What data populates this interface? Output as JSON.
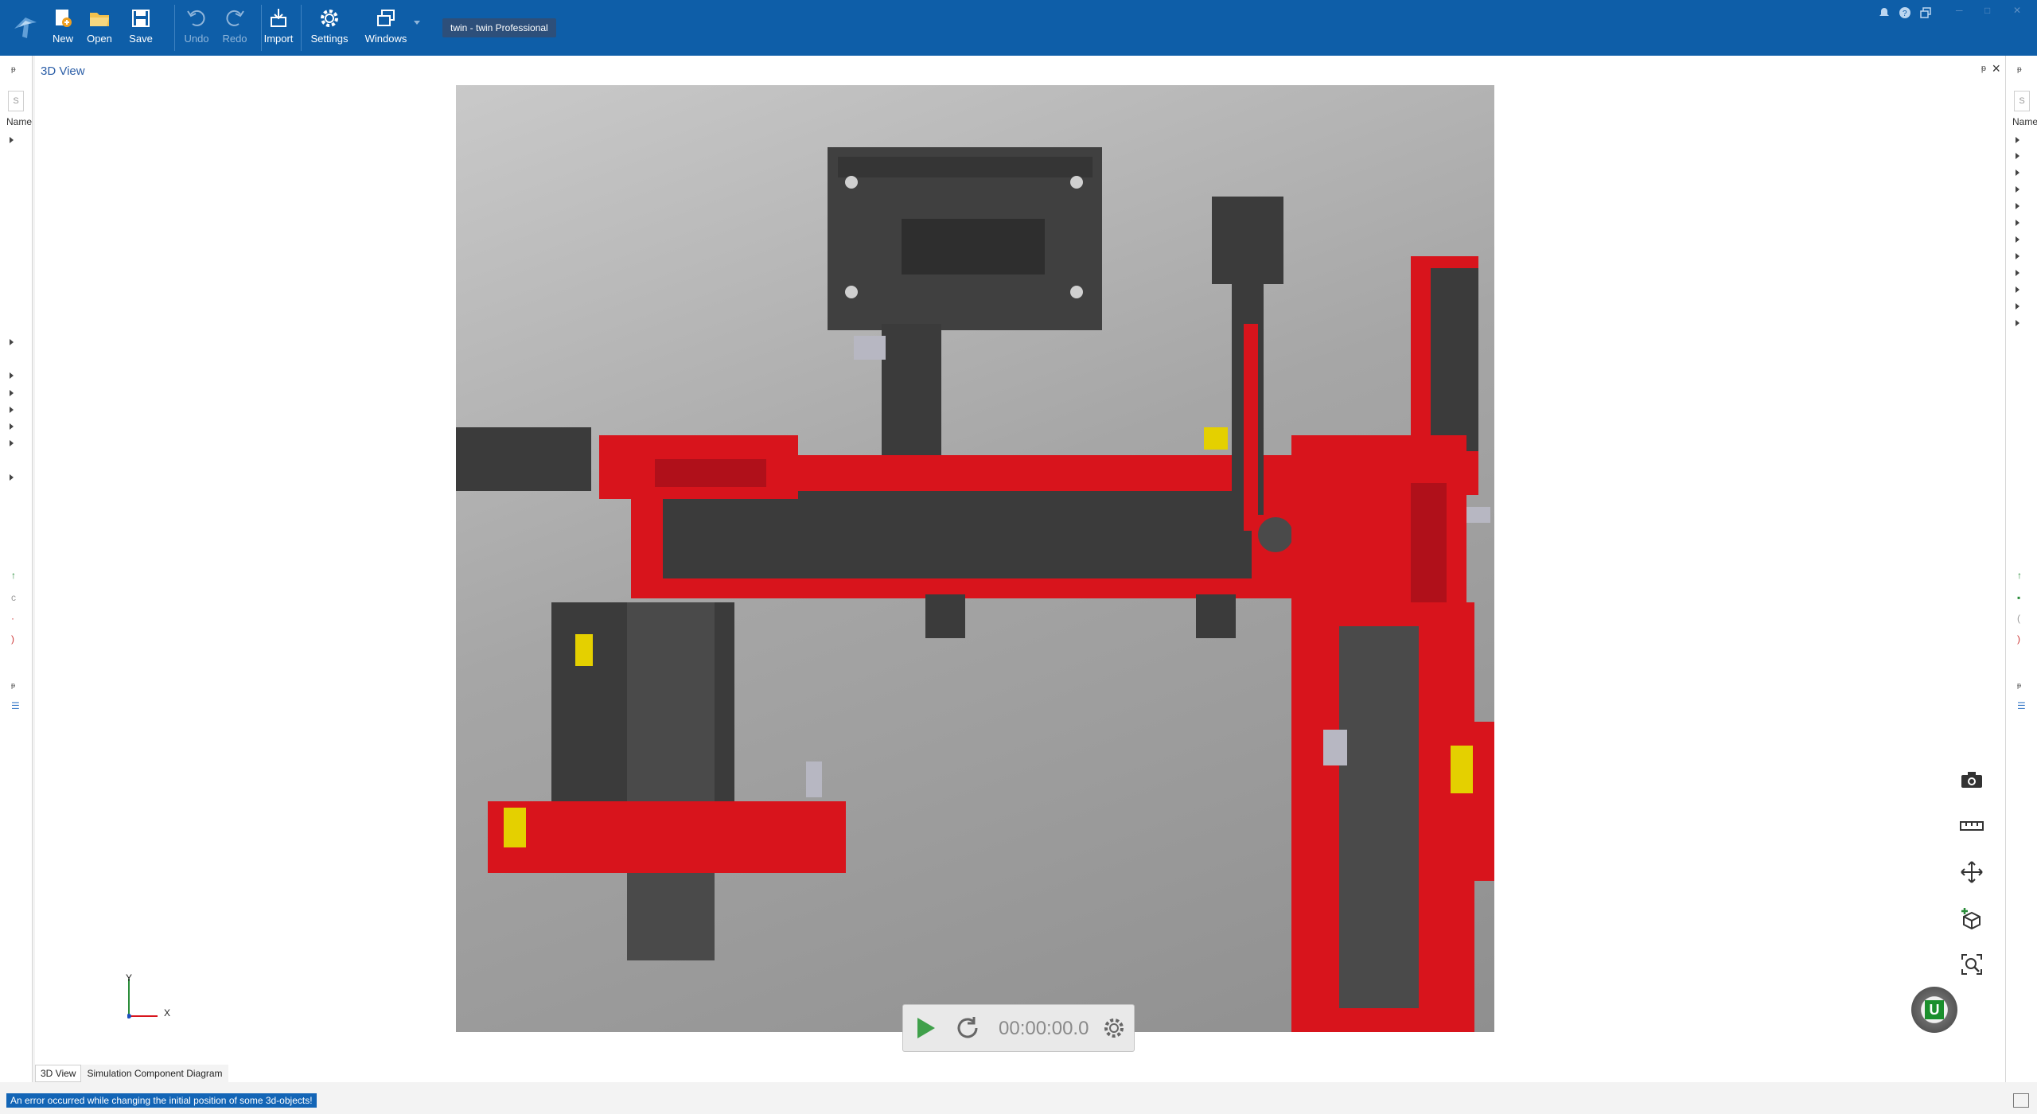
{
  "ribbon": {
    "new_label": "New",
    "open_label": "Open",
    "save_label": "Save",
    "undo_label": "Undo",
    "redo_label": "Redo",
    "import_label": "Import",
    "settings_label": "Settings",
    "windows_label": "Windows",
    "title": "twin - twin Professional"
  },
  "left_panel": {
    "pin": "ᵽ",
    "search_box": "S",
    "column_header": "Name"
  },
  "right_panel": {
    "pin": "ᵽ",
    "search_box": "S",
    "column_header": "Name"
  },
  "view": {
    "title": "3D View",
    "axis_x": "X",
    "axis_y": "Y",
    "timer": "00:00:00.0",
    "badge": "U"
  },
  "tabs": [
    "3D View",
    "Simulation Component Diagram"
  ],
  "status": {
    "message": "An error occurred while changing the initial position of some 3d-objects!"
  },
  "colors": {
    "ribbon": "#0e5ea8",
    "machine_red": "#d8141c",
    "machine_dark": "#3b3b3b",
    "accent_yellow": "#e4d000"
  }
}
